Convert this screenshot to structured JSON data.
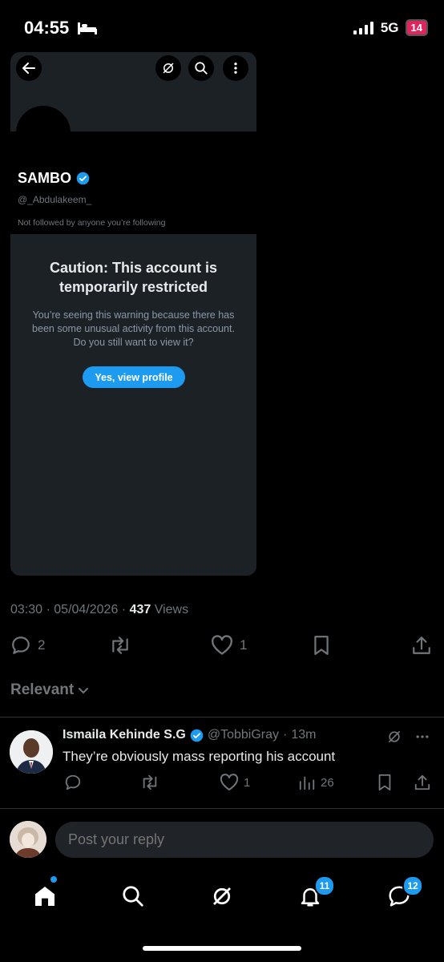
{
  "status_bar": {
    "time": "04:55",
    "network": "5G",
    "battery": "14"
  },
  "card": {
    "name": "SAMBO",
    "handle": "@_Abdulakeem_",
    "followed_note": "Not followed by anyone you’re following",
    "warning_title_line1": "Caution: This account is",
    "warning_title_line2": "temporarily restricted",
    "warning_body": "You’re seeing this warning because there has been some unusual activity from this account. Do you still want to view it?",
    "view_button": "Yes, view profile"
  },
  "post": {
    "time": "03:30",
    "date": "05/04/2026",
    "views_count": "437",
    "views_label": "Views",
    "replies": "2",
    "likes": "1"
  },
  "sort_label": "Relevant",
  "reply": {
    "name": "Ismaila Kehinde S.G",
    "handle": "@TobbiGray",
    "age": "13m",
    "text": "They’re obviously mass reporting his account",
    "likes": "1",
    "views": "26"
  },
  "compose": {
    "placeholder": "Post your reply"
  },
  "nav": {
    "notifications_badge": "11",
    "messages_badge": "12"
  },
  "colors": {
    "accent": "#1d9bf0",
    "background": "#000000",
    "card": "#1c2126"
  }
}
